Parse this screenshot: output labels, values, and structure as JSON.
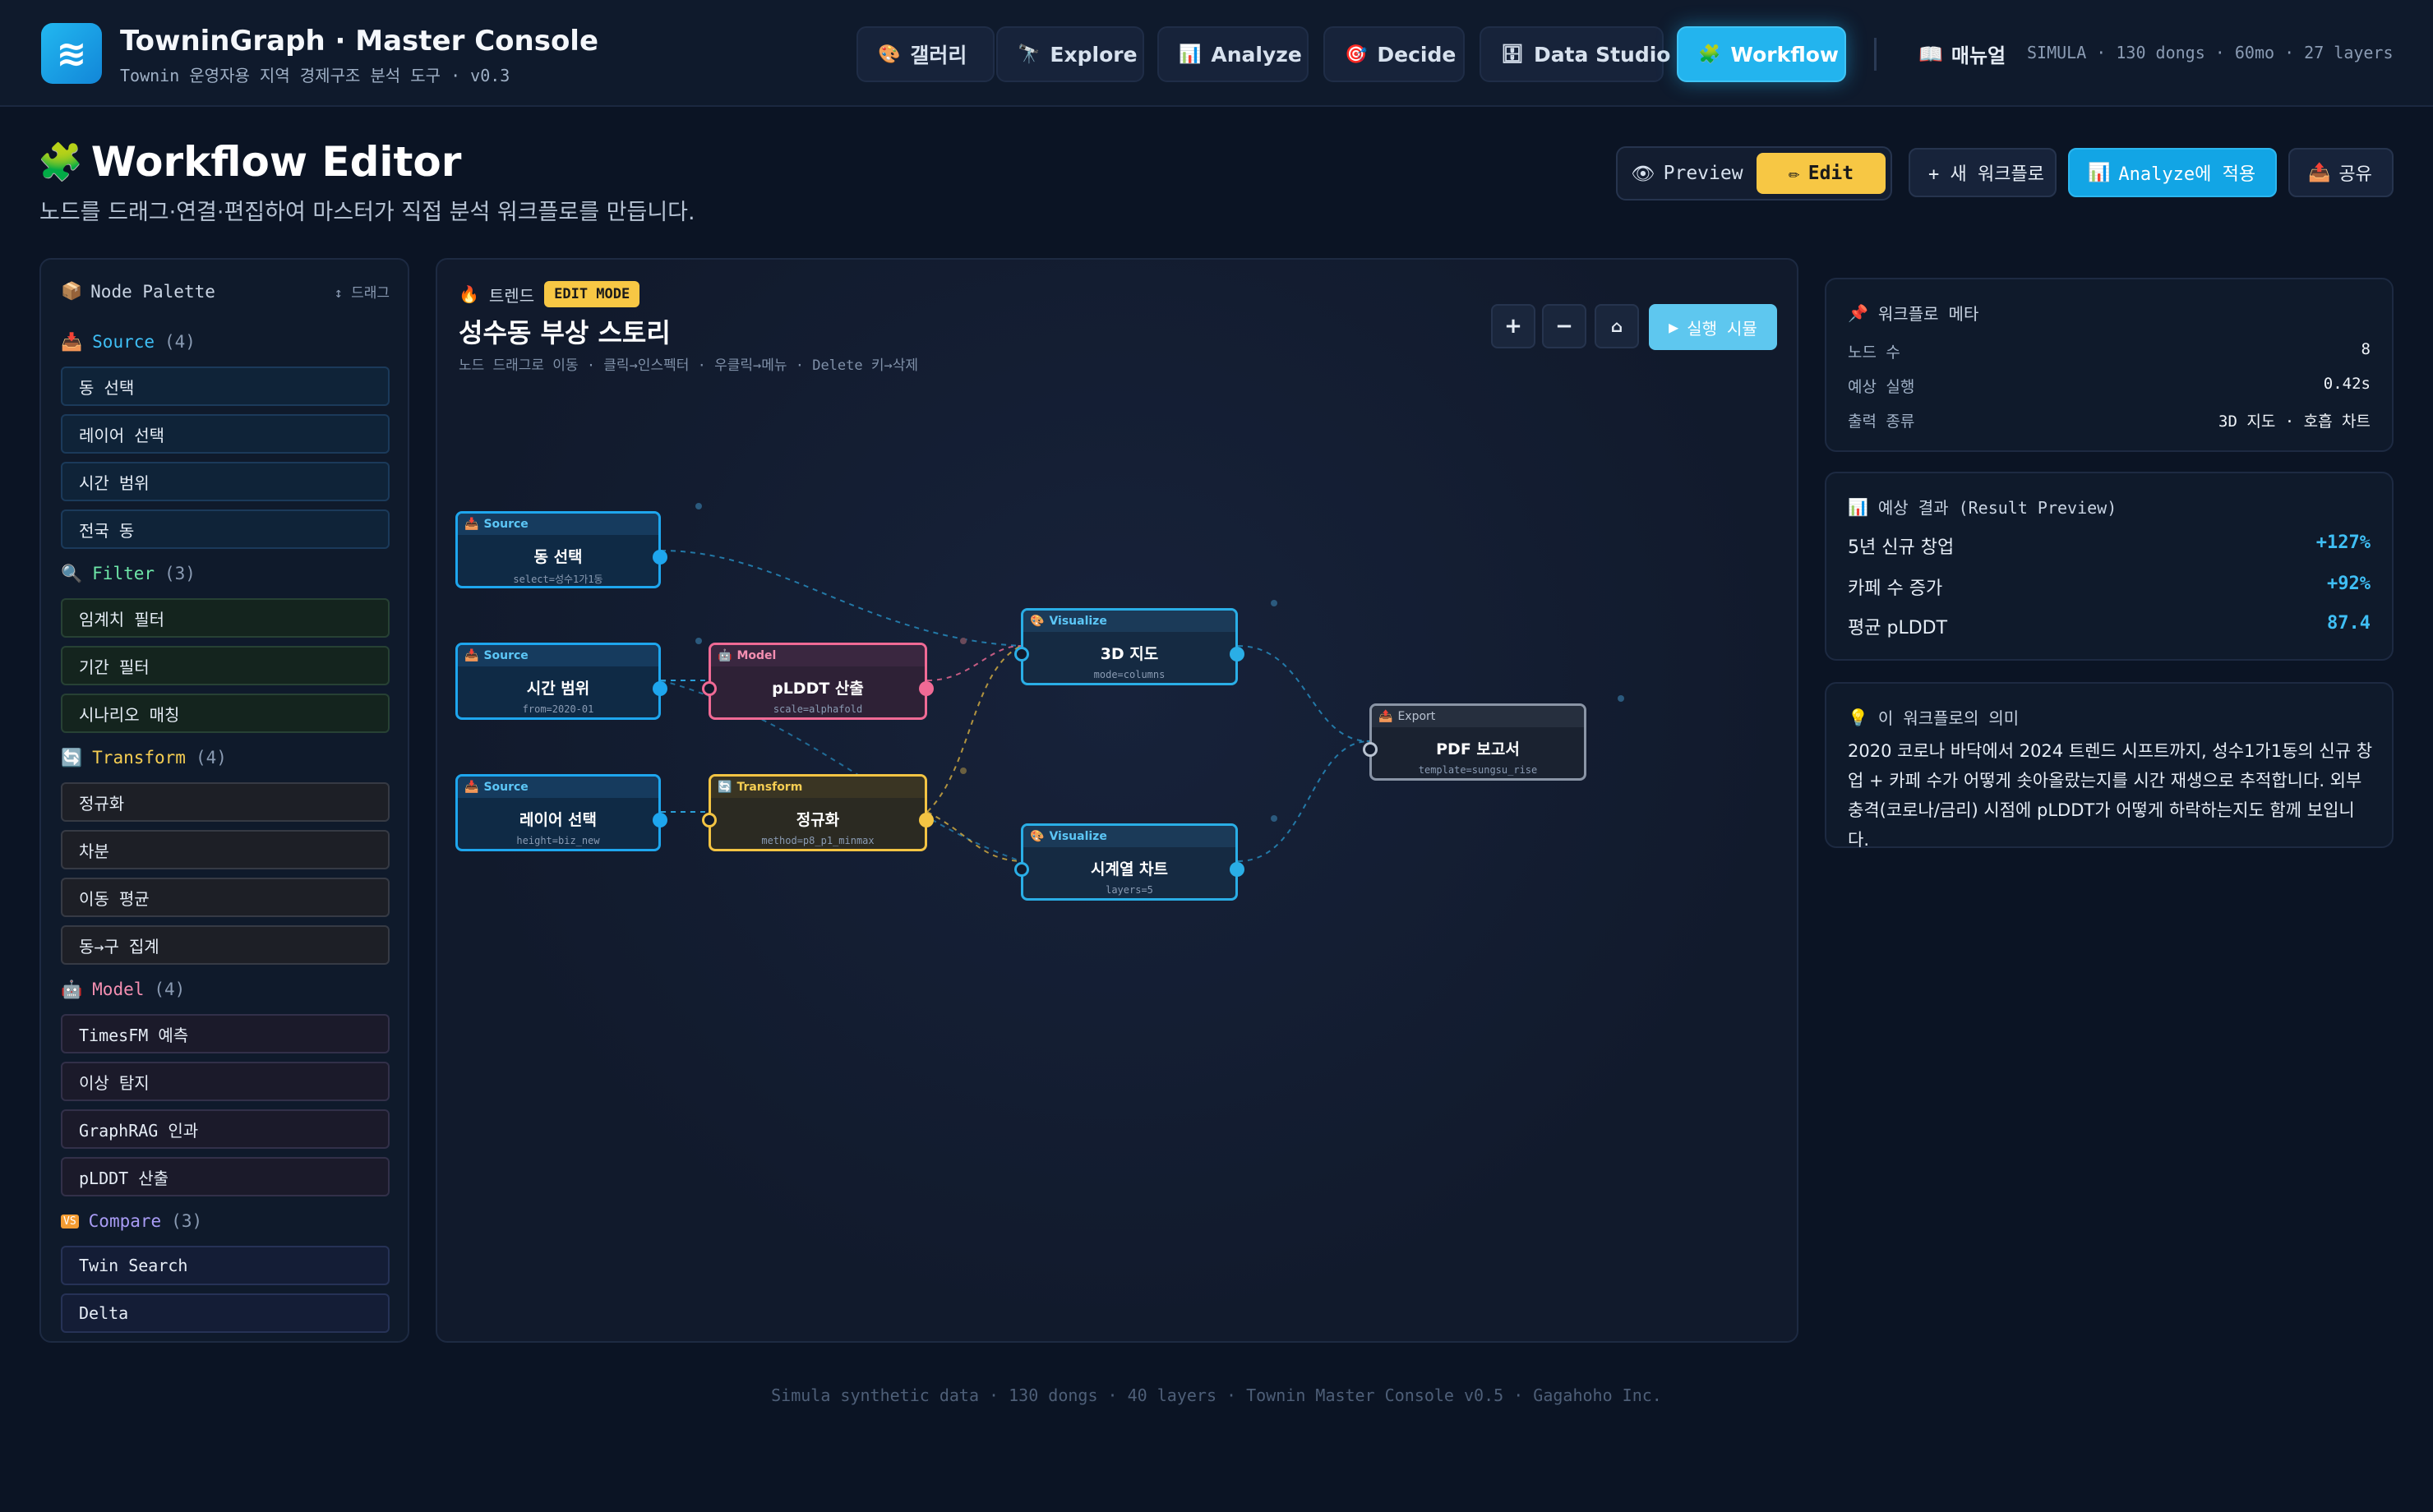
{
  "app": {
    "title": "TowninGraph · Master Console",
    "subtitle": "Townin 운영자용 지역 경제구조 분석 도구 · v0.3"
  },
  "nav": {
    "items": [
      {
        "label": "갤러리",
        "icon": "palette-icon",
        "glyph": "🎨"
      },
      {
        "label": "Explore",
        "icon": "telescope-icon",
        "glyph": "🔭"
      },
      {
        "label": "Analyze",
        "icon": "bar-chart-icon",
        "glyph": "📊"
      },
      {
        "label": "Decide",
        "icon": "target-icon",
        "glyph": "🎯"
      },
      {
        "label": "Data Studio",
        "icon": "database-icon",
        "glyph": "🗄"
      },
      {
        "label": "Workflow",
        "icon": "puzzle-icon",
        "glyph": "🧩"
      }
    ],
    "manual": "매뉴얼",
    "sim_status": "SIMULA · 130 dongs · 60mo · 27 layers"
  },
  "header": {
    "title": "Workflow Editor",
    "description": "노드를 드래그·연결·편집하여 마스터가 직접 분석 워크플로를 만듭니다.",
    "mode_preview": "Preview",
    "mode_edit": "Edit",
    "new_workflow": "+ 새 워크플로",
    "apply_analyze": "Analyze에 적용",
    "share": "공유"
  },
  "palette": {
    "title": "Node Palette",
    "drag_hint": "↕ 드래그",
    "categories": [
      {
        "name": "Source",
        "count": "(4)",
        "color": "#3fbff5",
        "items": [
          "동 선택",
          "레이어 선택",
          "시간 범위",
          "전국 동"
        ]
      },
      {
        "name": "Filter",
        "count": "(3)",
        "color": "#6ee7a8",
        "items": [
          "임계치 필터",
          "기간 필터",
          "시나리오 매칭"
        ]
      },
      {
        "name": "Transform",
        "count": "(4)",
        "color": "#f5cd52",
        "items": [
          "정규화",
          "차분",
          "이동 평균",
          "동→구 집계"
        ]
      },
      {
        "name": "Model",
        "count": "(4)",
        "color": "#f48fb1",
        "items": [
          "TimesFM 예측",
          "이상 탐지",
          "GraphRAG 인과",
          "pLDDT 산출"
        ]
      },
      {
        "name": "Compare",
        "count": "(3)",
        "color": "#a99cf5",
        "items": [
          "Twin Search",
          "Delta"
        ]
      }
    ]
  },
  "canvas": {
    "category": "트렌드",
    "badge": "EDIT MODE",
    "title": "성수동 부상 스토리",
    "hint": "노드 드래그로 이동 · 클릭→인스펙터 · 우클릭→메뉴 · Delete 키→삭제",
    "zoom_in": "+",
    "zoom_out": "−",
    "home": "⌂",
    "run": "실행 시뮬",
    "nodes": {
      "src1": {
        "type": "Source",
        "title": "동 선택",
        "param": "select=성수1가1동"
      },
      "src2": {
        "type": "Source",
        "title": "시간 범위",
        "param": "from=2020-01"
      },
      "src3": {
        "type": "Source",
        "title": "레이어 선택",
        "param": "height=biz_new"
      },
      "mdl": {
        "type": "Model",
        "title": "pLDDT 산출",
        "param": "scale=alphafold"
      },
      "trf": {
        "type": "Transform",
        "title": "정규화",
        "param": "method=p8_p1_minmax"
      },
      "viz1": {
        "type": "Visualize",
        "title": "3D 지도",
        "param": "mode=columns"
      },
      "viz2": {
        "type": "Visualize",
        "title": "시계열 차트",
        "param": "layers=5"
      },
      "exp": {
        "type": "Export",
        "title": "PDF 보고서",
        "param": "template=sungsu_rise"
      }
    }
  },
  "meta": {
    "title": "워크플로 메타",
    "rows": [
      {
        "k": "노드 수",
        "v": "8"
      },
      {
        "k": "예상 실행",
        "v": "0.42s"
      },
      {
        "k": "출력 종류",
        "v": "3D 지도 · 호흡 차트"
      }
    ]
  },
  "result": {
    "title": "예상 결과 (Result Preview)",
    "rows": [
      {
        "k": "5년 신규 창업",
        "v": "+127%"
      },
      {
        "k": "카페 수 증가",
        "v": "+92%"
      },
      {
        "k": "평균 pLDDT",
        "v": "87.4"
      }
    ]
  },
  "meaning": {
    "title": "이 워크플로의 의미",
    "text": "2020 코로나 바닥에서 2024 트렌드 시프트까지, 성수1가1동의 신규 창업 + 카페 수가 어떻게 솟아올랐는지를 시간 재생으로 추적합니다. 외부 충격(코로나/금리) 시점에 pLDDT가 어떻게 하락하는지도 함께 보입니다."
  },
  "footer": "Simula synthetic data · 130 dongs · 40 layers · Townin Master Console v0.5 · Gagahoho Inc."
}
